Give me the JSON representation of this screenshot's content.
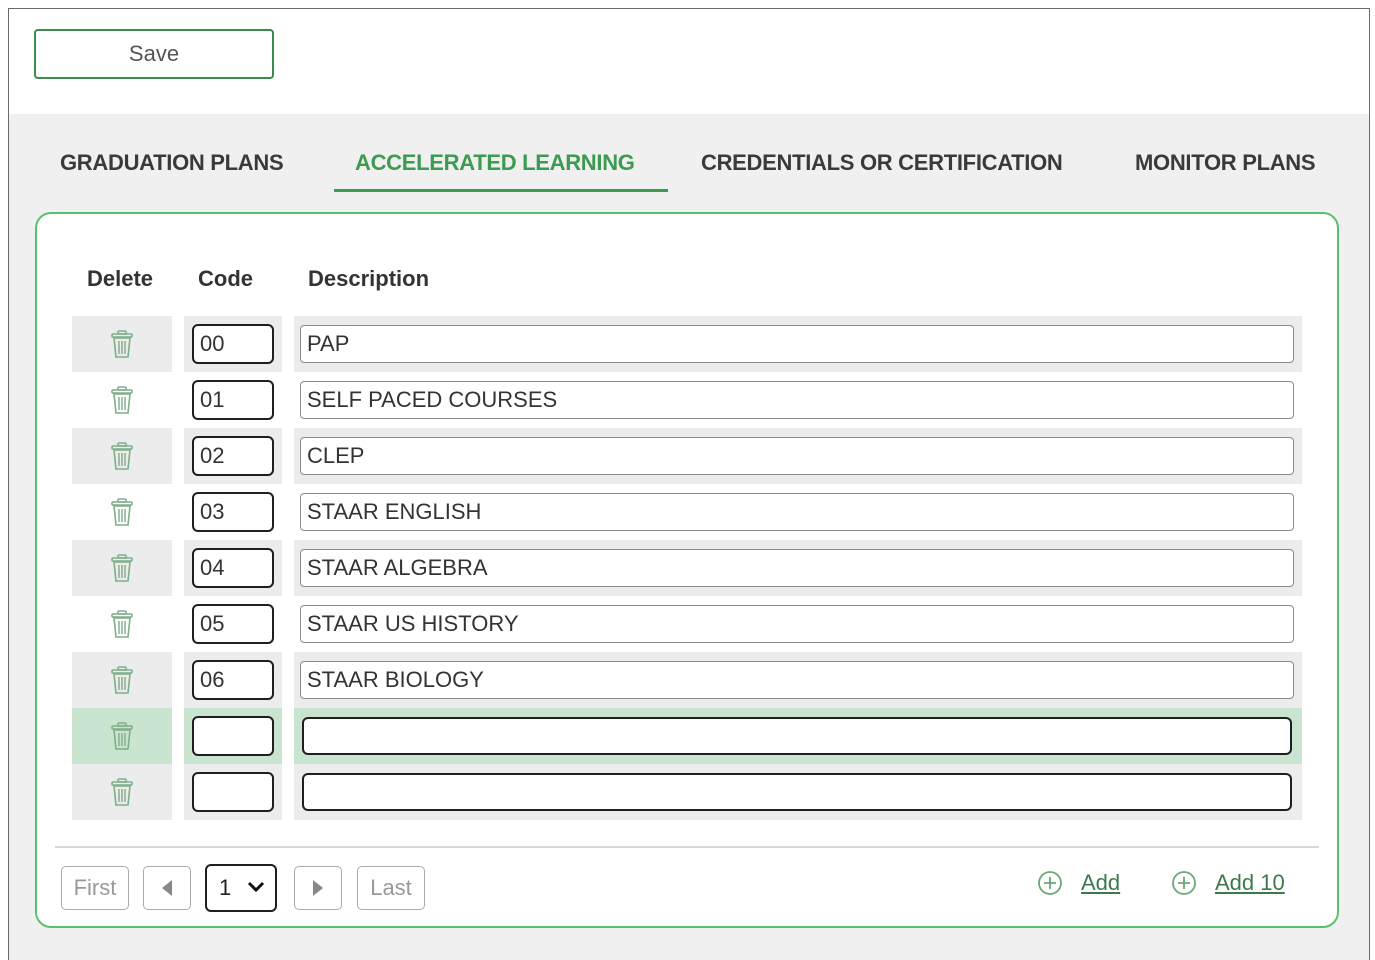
{
  "toolbar": {
    "save_label": "Save"
  },
  "tabs": [
    {
      "label": "GRADUATION PLANS",
      "active": false
    },
    {
      "label": "ACCELERATED LEARNING",
      "active": true
    },
    {
      "label": "CREDENTIALS OR CERTIFICATION",
      "active": false
    },
    {
      "label": "MONITOR PLANS",
      "active": false
    }
  ],
  "table": {
    "headers": {
      "delete": "Delete",
      "code": "Code",
      "description": "Description"
    },
    "rows": [
      {
        "code": "00",
        "description": "PAP"
      },
      {
        "code": "01",
        "description": "SELF PACED COURSES"
      },
      {
        "code": "02",
        "description": "CLEP"
      },
      {
        "code": "03",
        "description": "STAAR ENGLISH"
      },
      {
        "code": "04",
        "description": "STAAR ALGEBRA"
      },
      {
        "code": "05",
        "description": "STAAR US HISTORY"
      },
      {
        "code": "06",
        "description": "STAAR BIOLOGY"
      },
      {
        "code": "",
        "description": ""
      },
      {
        "code": "",
        "description": ""
      }
    ]
  },
  "pager": {
    "first_label": "First",
    "last_label": "Last",
    "page_value": "1"
  },
  "actions": {
    "add_label": "Add",
    "add10_label": "Add 10"
  },
  "colors": {
    "accent": "#3c9a51",
    "panel_border": "#5cbf6f",
    "highlight_row": "#c9e5cf"
  }
}
